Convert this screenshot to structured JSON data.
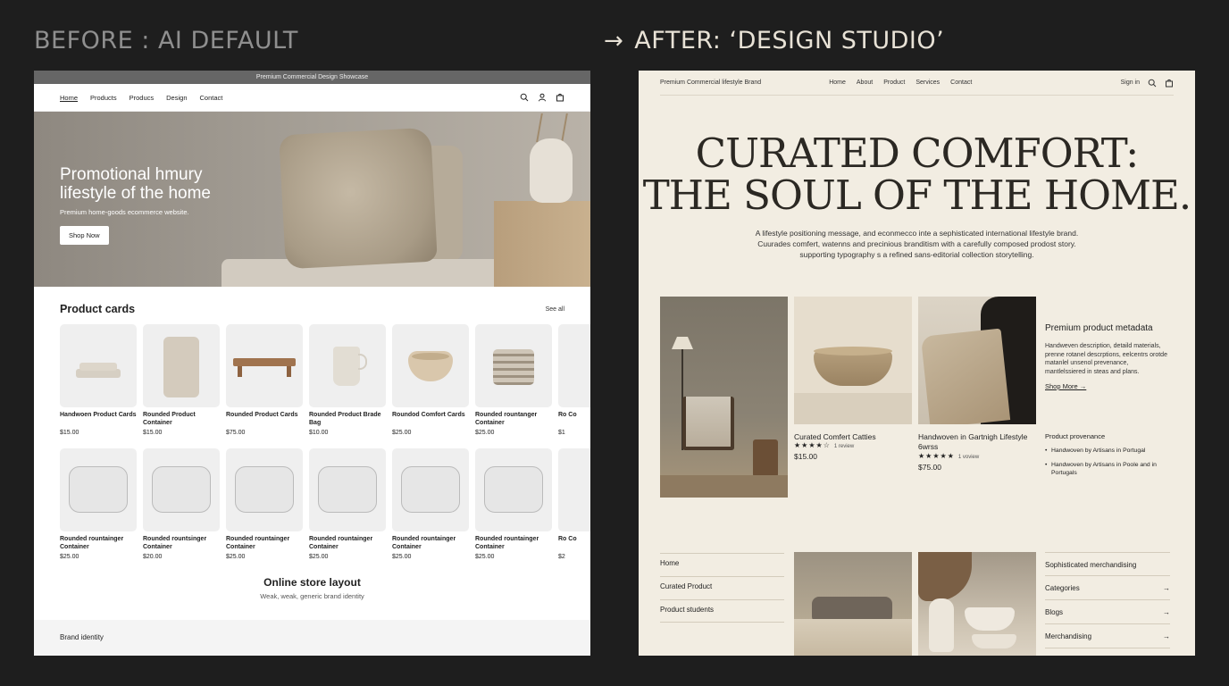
{
  "headings": {
    "before": "BEFORE : AI DEFAULT",
    "after": "AFTER: ‘DESIGN STUDIO’"
  },
  "before": {
    "topbar": "Premium Commercial Design Showcase",
    "nav": [
      "Home",
      "Products",
      "Producs",
      "Design",
      "Contact"
    ],
    "hero": {
      "title": "Promotional hmury lifestyle of the home",
      "subtitle": "Premium home-goods ecommerce website.",
      "cta": "Shop Now"
    },
    "products_title": "Product cards",
    "see_all": "See all",
    "row1": [
      {
        "name": "Handwoen Product Cards",
        "price": "$15.00"
      },
      {
        "name": "Rounded Product Container",
        "price": "$15.00"
      },
      {
        "name": "Rounded Product Cards",
        "price": "$75.00"
      },
      {
        "name": "Rounded Product Brade Bag",
        "price": "$10.00"
      },
      {
        "name": "Roundod Comfort Cards",
        "price": "$25.00"
      },
      {
        "name": "Rounded rountanger Container",
        "price": "$25.00"
      },
      {
        "name": "Ro Co",
        "price": "$1"
      }
    ],
    "row2": [
      {
        "name": "Rounded rountainger Container",
        "price": "$25.00"
      },
      {
        "name": "Rounded rountsinger Container",
        "price": "$20.00"
      },
      {
        "name": "Rounded rountainger Container",
        "price": "$25.00"
      },
      {
        "name": "Rounded rountainger Container",
        "price": "$25.00"
      },
      {
        "name": "Rounded rountainger Container",
        "price": "$25.00"
      },
      {
        "name": "Rounded rountainger Container",
        "price": "$25.00"
      },
      {
        "name": "Ro Co",
        "price": "$2"
      }
    ],
    "online_title": "Online store layout",
    "online_sub": "Weak, weak, generic brand identity",
    "brand": "Brand identity"
  },
  "after": {
    "brand": "Premium Commercial lifestyle Brand",
    "nav": [
      "Home",
      "About",
      "Product",
      "Services",
      "Contact"
    ],
    "signin": "Sign in",
    "hero_line1": "CURATED COMFORT:",
    "hero_line2": "THE SOUL OF THE HOME.",
    "sub_lines": [
      "A lifestyle positioning message, and econmecco inte a sephisticated international lifestyle brand.",
      "Cuurades comfert, watenns and precinious branditism with a carefully composed prodost story.",
      "supporting typography s a refined sans-editorial collection storytelling."
    ],
    "product1": {
      "name": "Curated Comfert Catties",
      "stars": "★★★★☆",
      "reviews": "1 review",
      "price": "$15.00"
    },
    "product2": {
      "name": "Handwoven in Gartnigh Lifestyle 6wrss",
      "stars": "★★★★★",
      "reviews": "1 voview",
      "price": "$75.00"
    },
    "meta_title": "Premium product metadata",
    "meta_text": "Handweven description, detaild materials, prenne rotanel descrptions, eelcentrs orotde matanlel unsenol prevenance, mantlelssiered in steas and plans.",
    "shop_more": "Shop More →",
    "provenance_title": "Product provenance",
    "provenance": [
      "Handwoven by Artisans in Portugal",
      "Handwoven by Artisans in Poole and in Portugals"
    ],
    "bottom_nav": [
      "Home",
      "Curated Product",
      "Product students"
    ],
    "right_list": [
      {
        "label": "Sophisticated merchandising",
        "arrow": ""
      },
      {
        "label": "Categories",
        "arrow": "→"
      },
      {
        "label": "Blogs",
        "arrow": "→"
      },
      {
        "label": "Merchandising",
        "arrow": "→"
      }
    ]
  }
}
